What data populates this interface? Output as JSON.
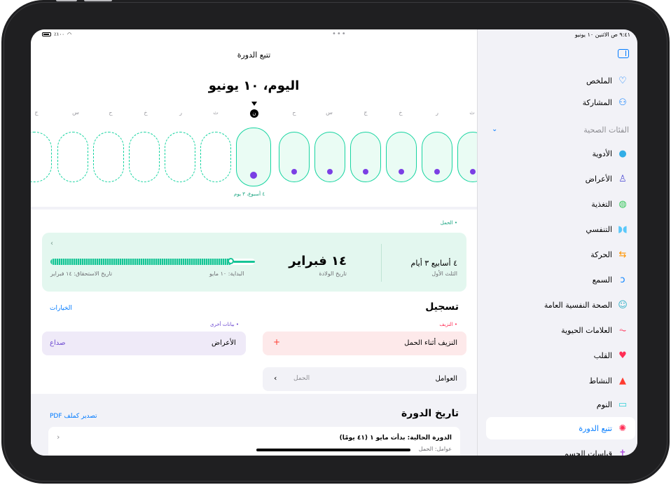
{
  "status": {
    "time": "٩:٤١ ص  الاثنين ١٠ يونيو",
    "battery": "٪١٠٠"
  },
  "sidebar": {
    "section_title": "الفئات الصحية",
    "items": [
      {
        "label": "الملخص",
        "icon": "heart-outline-icon",
        "color": "#007aff"
      },
      {
        "label": "المشاركة",
        "icon": "people-icon",
        "color": "#007aff"
      },
      {
        "label": "الأدوية",
        "icon": "pills-icon",
        "color": "#32ade6"
      },
      {
        "label": "الأعراض",
        "icon": "figure-icon",
        "color": "#5856d6"
      },
      {
        "label": "التغذية",
        "icon": "apple-icon",
        "color": "#34c759"
      },
      {
        "label": "التنفسي",
        "icon": "lungs-icon",
        "color": "#5ac8fa"
      },
      {
        "label": "الحركة",
        "icon": "arrows-icon",
        "color": "#ff9500"
      },
      {
        "label": "السمع",
        "icon": "ear-icon",
        "color": "#0a84ff"
      },
      {
        "label": "الصحة النفسية العامة",
        "icon": "mind-icon",
        "color": "#30b0c7"
      },
      {
        "label": "العلامات الحيوية",
        "icon": "vitals-icon",
        "color": "#ff2d55"
      },
      {
        "label": "القلب",
        "icon": "heart-fill-icon",
        "color": "#ff2d55"
      },
      {
        "label": "النشاط",
        "icon": "flame-icon",
        "color": "#ff3b30"
      },
      {
        "label": "النوم",
        "icon": "bed-icon",
        "color": "#2ecfd8"
      },
      {
        "label": "تتبع الدورة",
        "icon": "cycle-icon",
        "color": "#ff2d55"
      },
      {
        "label": "قياسات الجسم",
        "icon": "body-icon",
        "color": "#af52de"
      }
    ]
  },
  "main": {
    "title": "تتبع الدورة",
    "today": "اليوم، ١٠ يونيو",
    "day_letters": [
      "ج",
      "س",
      "ح",
      "خ",
      "ر",
      "ث",
      "ن",
      "ح",
      "س",
      "ج",
      "خ",
      "ر",
      "ث"
    ],
    "today_letter": "ن",
    "week_note": "٤ أسبوع، ٣ يوم",
    "pregnancy": {
      "label": "الحمل",
      "due_date": "١٤ فبراير",
      "due_caption": "تاريخ الولادة",
      "weeks": "٤ أسابيع ٣ أيام",
      "trimester": "الثلث الأول",
      "start": "البداية: ١٠ مايو",
      "due": "تاريخ الاستحقاق: ١٤ فبراير",
      "progress": 0.88
    },
    "logging": {
      "title": "تسجيل",
      "options": "الخيارات",
      "bleeding_label": "النزيف",
      "bleeding_item": "النزيف أثناء الحمل",
      "plus": "+",
      "other_label": "بيانات أخرى",
      "symptoms_label": "الأعراض",
      "symptoms_value": "صداع",
      "factors_label": "العوامل",
      "factors_value": "الحمل",
      "chevron": "‹"
    },
    "history": {
      "title": "تاريخ الدورة",
      "export": "تصدير كملف PDF",
      "current": "الدورة الحالية: بدأت مايو ١ (٤١ يومًا)",
      "factors": "عوامل: الحمل",
      "chevron": "›"
    }
  }
}
